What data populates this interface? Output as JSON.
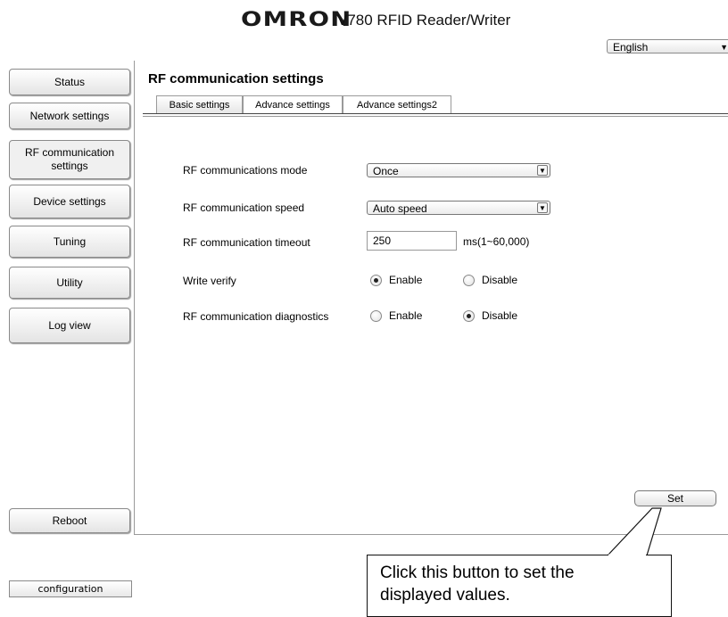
{
  "header": {
    "logo": "OMRON",
    "title": "V780 RFID Reader/Writer",
    "language": {
      "selected": "English",
      "arrow_icon": "triangle-down-icon"
    }
  },
  "sidebar": {
    "items": [
      {
        "label": "Status",
        "active": false
      },
      {
        "label": "Network settings",
        "active": false
      },
      {
        "label": "RF communication settings",
        "active": true
      },
      {
        "label": "Device settings",
        "active": false
      },
      {
        "label": "Tuning",
        "active": false
      },
      {
        "label": "Utility",
        "active": false
      },
      {
        "label": "Log view",
        "active": false
      }
    ],
    "reboot_label": "Reboot"
  },
  "main": {
    "title": "RF communication settings",
    "tabs": [
      {
        "label": "Basic settings",
        "active": true
      },
      {
        "label": "Advance settings",
        "active": false
      },
      {
        "label": "Advance settings2",
        "active": false
      }
    ],
    "fields": {
      "mode": {
        "label": "RF communications mode",
        "value": "Once"
      },
      "speed": {
        "label": "RF communication speed",
        "value": "Auto speed"
      },
      "timeout": {
        "label": "RF communication timeout",
        "value": "250",
        "hint": "ms(1~60,000)"
      },
      "write_verify": {
        "label": "Write verify",
        "options": [
          "Enable",
          "Disable"
        ],
        "selected": "Enable"
      },
      "diagnostics": {
        "label": "RF communication diagnostics",
        "options": [
          "Enable",
          "Disable"
        ],
        "selected": "Disable"
      }
    },
    "set_label": "Set"
  },
  "footer": {
    "configuration_label": "configuration"
  },
  "callout": {
    "line1": "Click this button to set the",
    "line2": "displayed values."
  }
}
